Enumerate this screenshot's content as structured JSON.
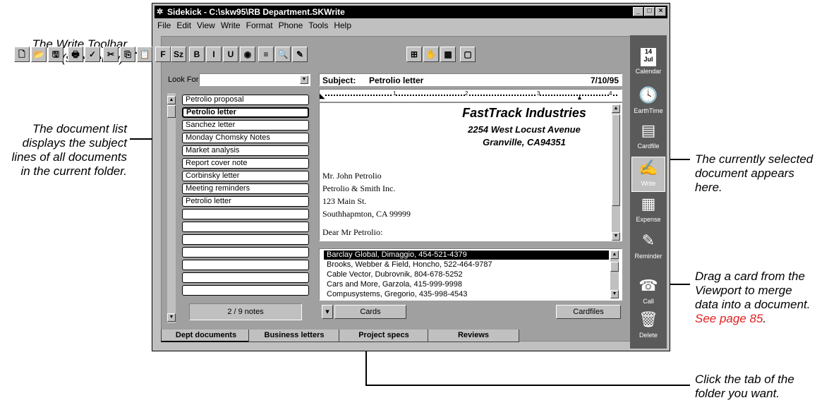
{
  "callouts": {
    "toolbar": "The Write Toolbar (see below).",
    "doclist": "The document list displays the subject lines of all documents in the current folder.",
    "selected": "The currently selected document appears here.",
    "drag_pre": "Drag a card from the Viewport to merge data into a document. ",
    "drag_link": "See page 85",
    "drag_post": ".",
    "tabs": "Click the tab of the folder you want."
  },
  "window": {
    "title": "Sidekick - C:\\skw95\\RB Department.SKWrite",
    "controls": [
      "_",
      "□",
      "×"
    ]
  },
  "menu": [
    "File",
    "Edit",
    "View",
    "Write",
    "Format",
    "Phone",
    "Tools",
    "Help"
  ],
  "toolbar": {
    "buttons": [
      {
        "name": "new-icon",
        "glyph": "🗋"
      },
      {
        "name": "open-icon",
        "glyph": "📂"
      },
      {
        "name": "save-icon",
        "glyph": "🖫"
      },
      {
        "name": "print-icon",
        "glyph": "🖶"
      },
      {
        "name": "spellcheck-icon",
        "glyph": "✓"
      },
      {
        "name": "cut-icon",
        "glyph": "✂"
      },
      {
        "name": "copy-icon",
        "glyph": "⎘"
      },
      {
        "name": "paste-icon",
        "glyph": "📋"
      },
      {
        "name": "font-icon",
        "glyph": "F"
      },
      {
        "name": "size-icon",
        "glyph": "Sz"
      },
      {
        "name": "bold-icon",
        "glyph": "B"
      },
      {
        "name": "italic-icon",
        "glyph": "I"
      },
      {
        "name": "underline-icon",
        "glyph": "U"
      },
      {
        "name": "color-icon",
        "glyph": "◉"
      },
      {
        "name": "align-icon",
        "glyph": "≡"
      },
      {
        "name": "find-icon",
        "glyph": "🔍"
      },
      {
        "name": "edit-icon",
        "glyph": "✎"
      },
      {
        "name": "merge-icon",
        "glyph": "⊞"
      },
      {
        "name": "handshake-icon",
        "glyph": "✋"
      },
      {
        "name": "calculator-icon",
        "glyph": "▦"
      },
      {
        "name": "note-icon",
        "glyph": "▢"
      }
    ]
  },
  "doclist": {
    "lookfor_label": "Look For:",
    "items": [
      "Petrolio proposal",
      "Petrolio letter",
      "Sanchez letter",
      "Monday Chomsky Notes",
      "Market analysis",
      "Report cover note",
      "Corbinsky letter",
      "Meeting reminders",
      "Petrolio letter"
    ],
    "selected_index": 1,
    "empty_rows": 7,
    "count": "2 / 9 notes"
  },
  "document": {
    "subject_label": "Subject:",
    "subject": "Petrolio letter",
    "date": "7/10/95",
    "ruler": [
      "1",
      "2",
      "3",
      "4"
    ],
    "company": "FastTrack Industries",
    "address1": "2254 West Locust Avenue",
    "address2": "Granville, CA94351",
    "recipient": [
      "Mr. John Petrolio",
      "Petrolio & Smith Inc.",
      "123 Main St.",
      "Southhapmton, CA 99999"
    ],
    "salutation": "Dear Mr Petrolio:"
  },
  "viewport": {
    "cards": [
      "Barclay Global, Dimaggio, 454-521-4379",
      "Brooks, Webber & Field, Honcho, 522-464-9787",
      "Cable Vector, Dubrovnik, 804-678-5252",
      "Cars and More, Garzola, 415-999-9998",
      "Compusystems, Gregorio, 435-998-4543"
    ],
    "selected_index": 0,
    "cards_button": "Cards",
    "cardfiles_button": "Cardfiles"
  },
  "tabs": [
    "Dept documents",
    "Business letters",
    "Project specs",
    "Reviews"
  ],
  "sidebar": [
    {
      "name": "calendar",
      "label": "Calendar",
      "glyph": "14\nJul"
    },
    {
      "name": "earthtime",
      "label": "EarthTime",
      "glyph": "🕓"
    },
    {
      "name": "cardfile",
      "label": "Cardfile",
      "glyph": "▤"
    },
    {
      "name": "write",
      "label": "Write",
      "glyph": "✍"
    },
    {
      "name": "expense",
      "label": "Expense",
      "glyph": "▦"
    },
    {
      "name": "reminder",
      "label": "Reminder",
      "glyph": "✎"
    },
    {
      "name": "call",
      "label": "Call",
      "glyph": "☎"
    },
    {
      "name": "delete",
      "label": "Delete",
      "glyph": "🗑"
    }
  ]
}
